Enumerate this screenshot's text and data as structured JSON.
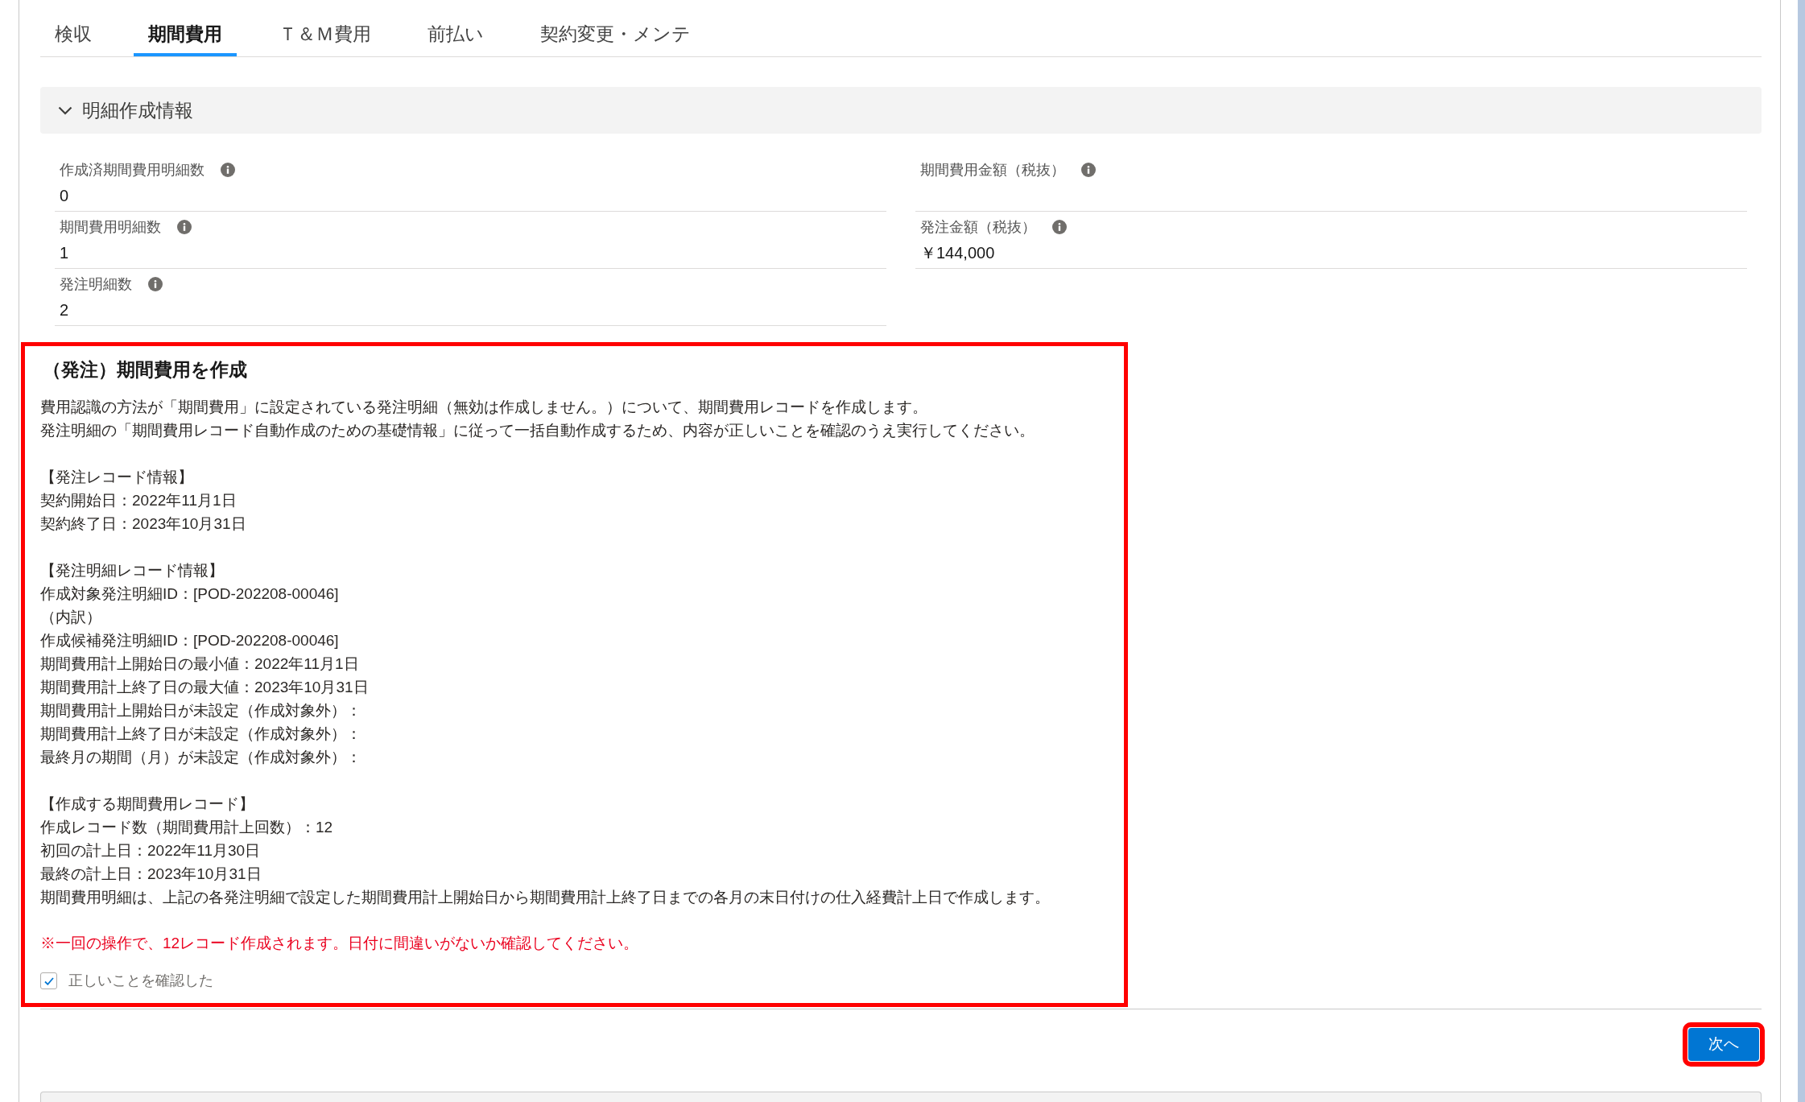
{
  "tabs": [
    {
      "label": "検収",
      "selected": false
    },
    {
      "label": "期間費用",
      "selected": true
    },
    {
      "label": "Ｔ＆Ｍ費用",
      "selected": false
    },
    {
      "label": "前払い",
      "selected": false
    },
    {
      "label": "契約変更・メンテ",
      "selected": false
    }
  ],
  "section": {
    "title": "明細作成情報",
    "expanded": true,
    "columns": [
      {
        "fields": [
          {
            "label": "作成済期間費用明細数",
            "value": "0"
          },
          {
            "label": "期間費用明細数",
            "value": "1"
          },
          {
            "label": "発注明細数",
            "value": "2"
          }
        ]
      },
      {
        "fields": [
          {
            "label": "期間費用金額（税抜）"
          },
          {
            "label": "発注金額（税抜）",
            "value": "￥144,000"
          }
        ]
      }
    ]
  },
  "create_panel": {
    "highlighted": true,
    "title": "（発注）期間費用を作成",
    "paragraphs": [
      {
        "lines": [
          "費用認識の方法が「期間費用」に設定されている発注明細（無効は作成しません。）について、期間費用レコードを作成します。",
          "発注明細の「期間費用レコード自動作成のための基礎情報」に従って一括自動作成するため、内容が正しいことを確認のうえ実行してください。"
        ]
      },
      {
        "lines": [
          "【発注レコード情報】",
          "契約開始日：2022年11月1日",
          "契約終了日：2023年10月31日"
        ]
      },
      {
        "lines": [
          "【発注明細レコード情報】",
          "作成対象発注明細ID：[POD-202208-00046]",
          "（内訳）",
          "作成候補発注明細ID：[POD-202208-00046]",
          "期間費用計上開始日の最小値：2022年11月1日",
          "期間費用計上終了日の最大値：2023年10月31日",
          "期間費用計上開始日が未設定（作成対象外）：",
          "期間費用計上終了日が未設定（作成対象外）：",
          "最終月の期間（月）が未設定（作成対象外）："
        ]
      },
      {
        "lines": [
          "【作成する期間費用レコード】",
          "作成レコード数（期間費用計上回数）：12",
          "初回の計上日：2022年11月30日",
          "最終の計上日：2023年10月31日",
          "期間費用明細は、上記の各発注明細で設定した期間費用計上開始日から期間費用計上終了日までの各月の末日付けの仕入経費計上日で作成します。"
        ]
      }
    ],
    "warning": "※一回の操作で、12レコード作成されます。日付に間違いがないか確認してください。",
    "confirm_checkbox": {
      "label": "正しいことを確認した",
      "checked": true
    }
  },
  "next_button": {
    "label": "次へ",
    "highlighted": true
  }
}
